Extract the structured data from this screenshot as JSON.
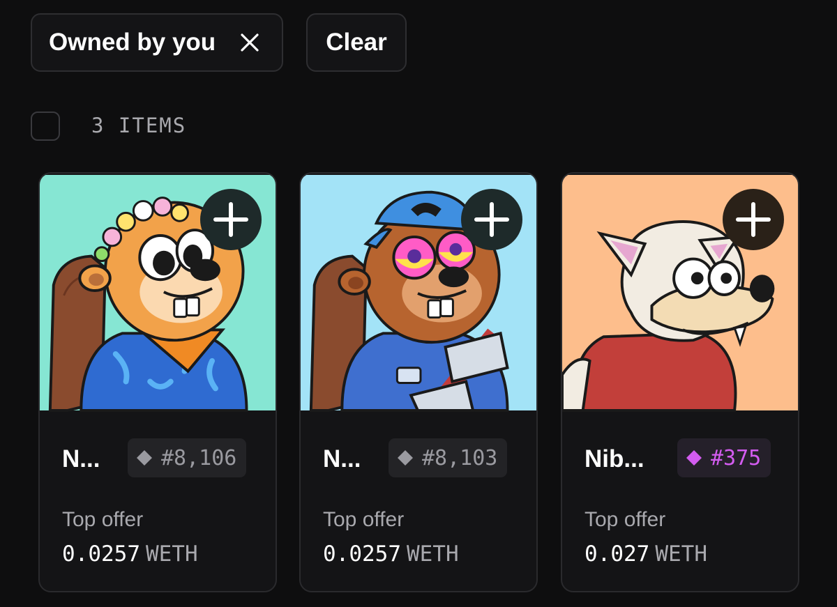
{
  "filters": {
    "owned_chip_label": "Owned by you",
    "clear_label": "Clear"
  },
  "items_count": "3 ITEMS",
  "cards": [
    {
      "name": "N...",
      "token_id": "#8,106",
      "top_offer_label": "Top offer",
      "top_offer_value": "0.0257",
      "currency": "WETH",
      "art_bg": "#86e6d3",
      "badge_color": "#9a9aa0"
    },
    {
      "name": "N...",
      "token_id": "#8,103",
      "top_offer_label": "Top offer",
      "top_offer_value": "0.0257",
      "currency": "WETH",
      "art_bg": "#a3e3f7",
      "badge_color": "#9a9aa0"
    },
    {
      "name": "Nib...",
      "token_id": "#375",
      "top_offer_label": "Top offer",
      "top_offer_value": "0.027",
      "currency": "WETH",
      "art_bg": "#fdbe8c",
      "badge_color": "#d35cf0"
    }
  ],
  "icons": {
    "close": "close-icon",
    "add": "plus-icon",
    "token": "diamond-icon"
  }
}
